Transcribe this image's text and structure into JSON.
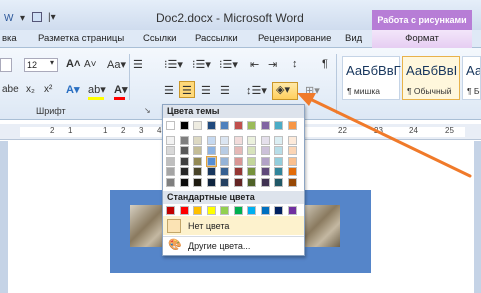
{
  "window": {
    "title": "Doc2.docx - Microsoft Word",
    "context_group": "Работа с рисунками"
  },
  "tabs": [
    "вка",
    "Разметка страницы",
    "Ссылки",
    "Рассылки",
    "Рецензирование",
    "Вид"
  ],
  "context_tab": "Формат",
  "font_group": {
    "label": "Шрифт",
    "size_value": "12"
  },
  "styles": [
    {
      "preview": "АаБбВвГ",
      "name": "¶ мишка"
    },
    {
      "preview": "АаБбВвI",
      "name": "¶ Обычный"
    },
    {
      "preview": "АаБбВв",
      "name": "¶ Без и"
    }
  ],
  "ruler_numbers": [
    "2",
    "1",
    "1",
    "2",
    "3",
    "4",
    "5",
    "6",
    "22",
    "23",
    "24",
    "25"
  ],
  "dropdown": {
    "theme_header": "Цвета темы",
    "standard_header": "Стандартные цвета",
    "no_color": "Нет цвета",
    "more_colors": "Другие цвета...",
    "theme_colors": [
      [
        "#ffffff",
        "#000000",
        "#eeece1",
        "#1f497d",
        "#4f81bd",
        "#c0504d",
        "#9bbb59",
        "#8064a2",
        "#4bacc6",
        "#f79646"
      ],
      [
        "#f2f2f2",
        "#7f7f7f",
        "#ddd9c3",
        "#c6d9f0",
        "#dbe5f1",
        "#f2dcdb",
        "#ebf1dd",
        "#e5e0ec",
        "#dbeef3",
        "#fdeada"
      ],
      [
        "#d8d8d8",
        "#595959",
        "#c4bd97",
        "#8db3e2",
        "#b8cce4",
        "#e5b9b7",
        "#d7e3bc",
        "#ccc1d9",
        "#b7dde8",
        "#fbd5b5"
      ],
      [
        "#bfbfbf",
        "#3f3f3f",
        "#938953",
        "#548dd4",
        "#95b3d7",
        "#d99694",
        "#c3d69b",
        "#b2a2c7",
        "#92cddc",
        "#fac08f"
      ],
      [
        "#a5a5a5",
        "#262626",
        "#494429",
        "#17365d",
        "#366092",
        "#953734",
        "#76923c",
        "#5f497a",
        "#31859b",
        "#e36c09"
      ],
      [
        "#7f7f7f",
        "#0c0c0c",
        "#1d1b10",
        "#0f243e",
        "#244061",
        "#632423",
        "#4f6128",
        "#3f3151",
        "#205867",
        "#974806"
      ]
    ],
    "standard_colors": [
      "#c00000",
      "#ff0000",
      "#ffc000",
      "#ffff00",
      "#92d050",
      "#00b050",
      "#00b0f0",
      "#0070c0",
      "#002060",
      "#7030a0"
    ]
  },
  "colors": {
    "context_accent": "#b77dd6",
    "arrow": "#f07a2a",
    "picture_fill": "#5585c9"
  },
  "icons": [
    "shading-icon",
    "bold-icon",
    "italic-icon",
    "align-center-icon",
    "bullets-icon",
    "palette-icon"
  ]
}
